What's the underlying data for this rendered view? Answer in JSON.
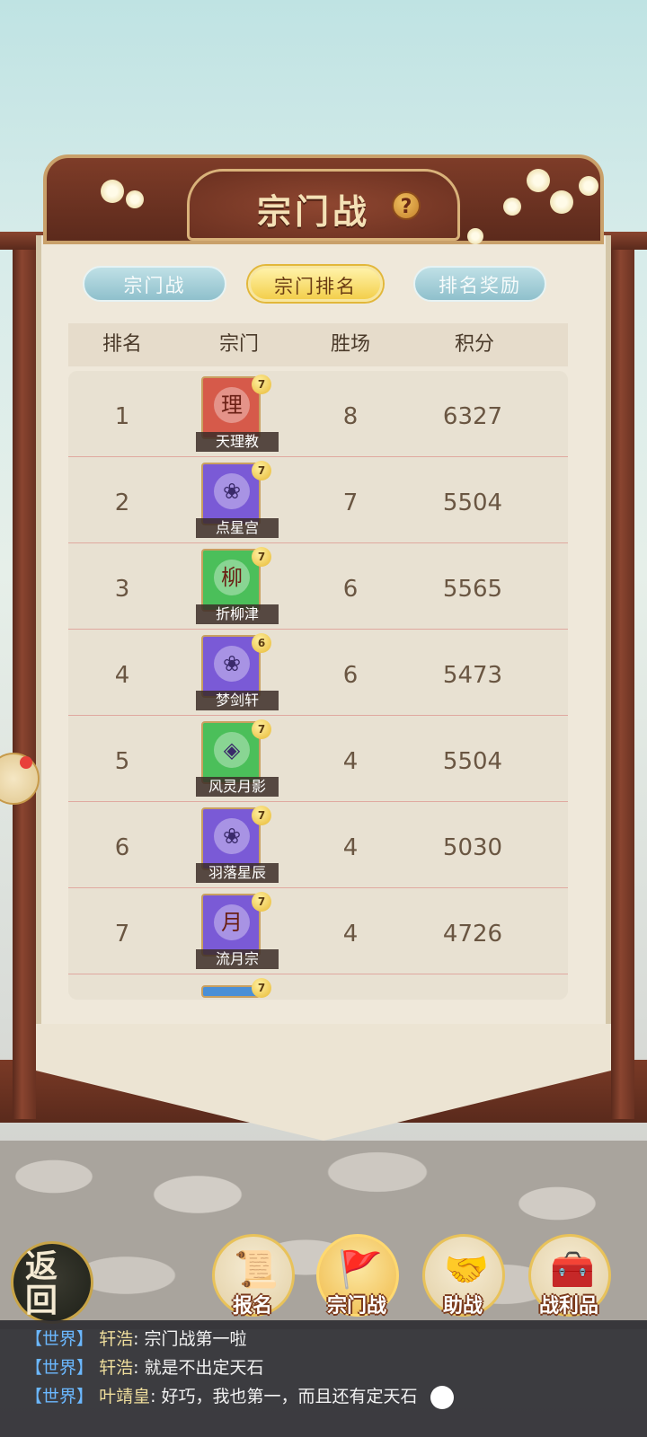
{
  "header": {
    "title": "宗门战",
    "help_glyph": "?"
  },
  "tabs": [
    {
      "label": "宗门战",
      "active": false
    },
    {
      "label": "宗门排名",
      "active": true
    },
    {
      "label": "排名奖励",
      "active": false
    }
  ],
  "table": {
    "columns": [
      "排名",
      "宗门",
      "胜场",
      "积分"
    ],
    "rows": [
      {
        "rank": "1",
        "sect": "天理教",
        "emblem": "理",
        "level": "7",
        "wins": "8",
        "score": "6327",
        "color": "#d65a4a"
      },
      {
        "rank": "2",
        "sect": "点星宫",
        "emblem": "lotus-icon",
        "level": "7",
        "wins": "7",
        "score": "5504",
        "color": "#7a5ad6"
      },
      {
        "rank": "3",
        "sect": "折柳津",
        "emblem": "柳",
        "level": "7",
        "wins": "6",
        "score": "5565",
        "color": "#4bbf5a"
      },
      {
        "rank": "4",
        "sect": "梦剑轩",
        "emblem": "lotus-icon",
        "level": "6",
        "wins": "6",
        "score": "5473",
        "color": "#7a5ad6"
      },
      {
        "rank": "5",
        "sect": "风灵月影",
        "emblem": "coin-icon",
        "level": "7",
        "wins": "4",
        "score": "5504",
        "color": "#4bbf5a"
      },
      {
        "rank": "6",
        "sect": "羽落星辰",
        "emblem": "lotus-icon",
        "level": "7",
        "wins": "4",
        "score": "5030",
        "color": "#7a5ad6"
      },
      {
        "rank": "7",
        "sect": "流月宗",
        "emblem": "月",
        "level": "7",
        "wins": "4",
        "score": "4726",
        "color": "#7a5ad6"
      }
    ],
    "partial_row": {
      "level": "7",
      "color": "#4a8fd6"
    }
  },
  "nav": {
    "back": "返回",
    "items": [
      {
        "label": "报名",
        "icon": "scroll-brush-icon",
        "active": false
      },
      {
        "label": "宗门战",
        "icon": "flag-mountain-icon",
        "active": true
      },
      {
        "label": "助战",
        "icon": "handshake-icon",
        "active": false
      },
      {
        "label": "战利品",
        "icon": "treasure-chest-icon",
        "active": false
      }
    ]
  },
  "chat": [
    {
      "channel": "【世界】",
      "name": "轩浩",
      "message": "宗门战第一啦"
    },
    {
      "channel": "【世界】",
      "name": "轩浩",
      "message": "就是不出定天石"
    },
    {
      "channel": "【世界】",
      "name": "叶靖皇",
      "message": "好巧，我也第一，而且还有定天石"
    }
  ],
  "colors": {
    "accent_gold": "#f3cf4c",
    "frame_brown": "#7e3c28",
    "tab_blue": "#8fc0cc"
  }
}
